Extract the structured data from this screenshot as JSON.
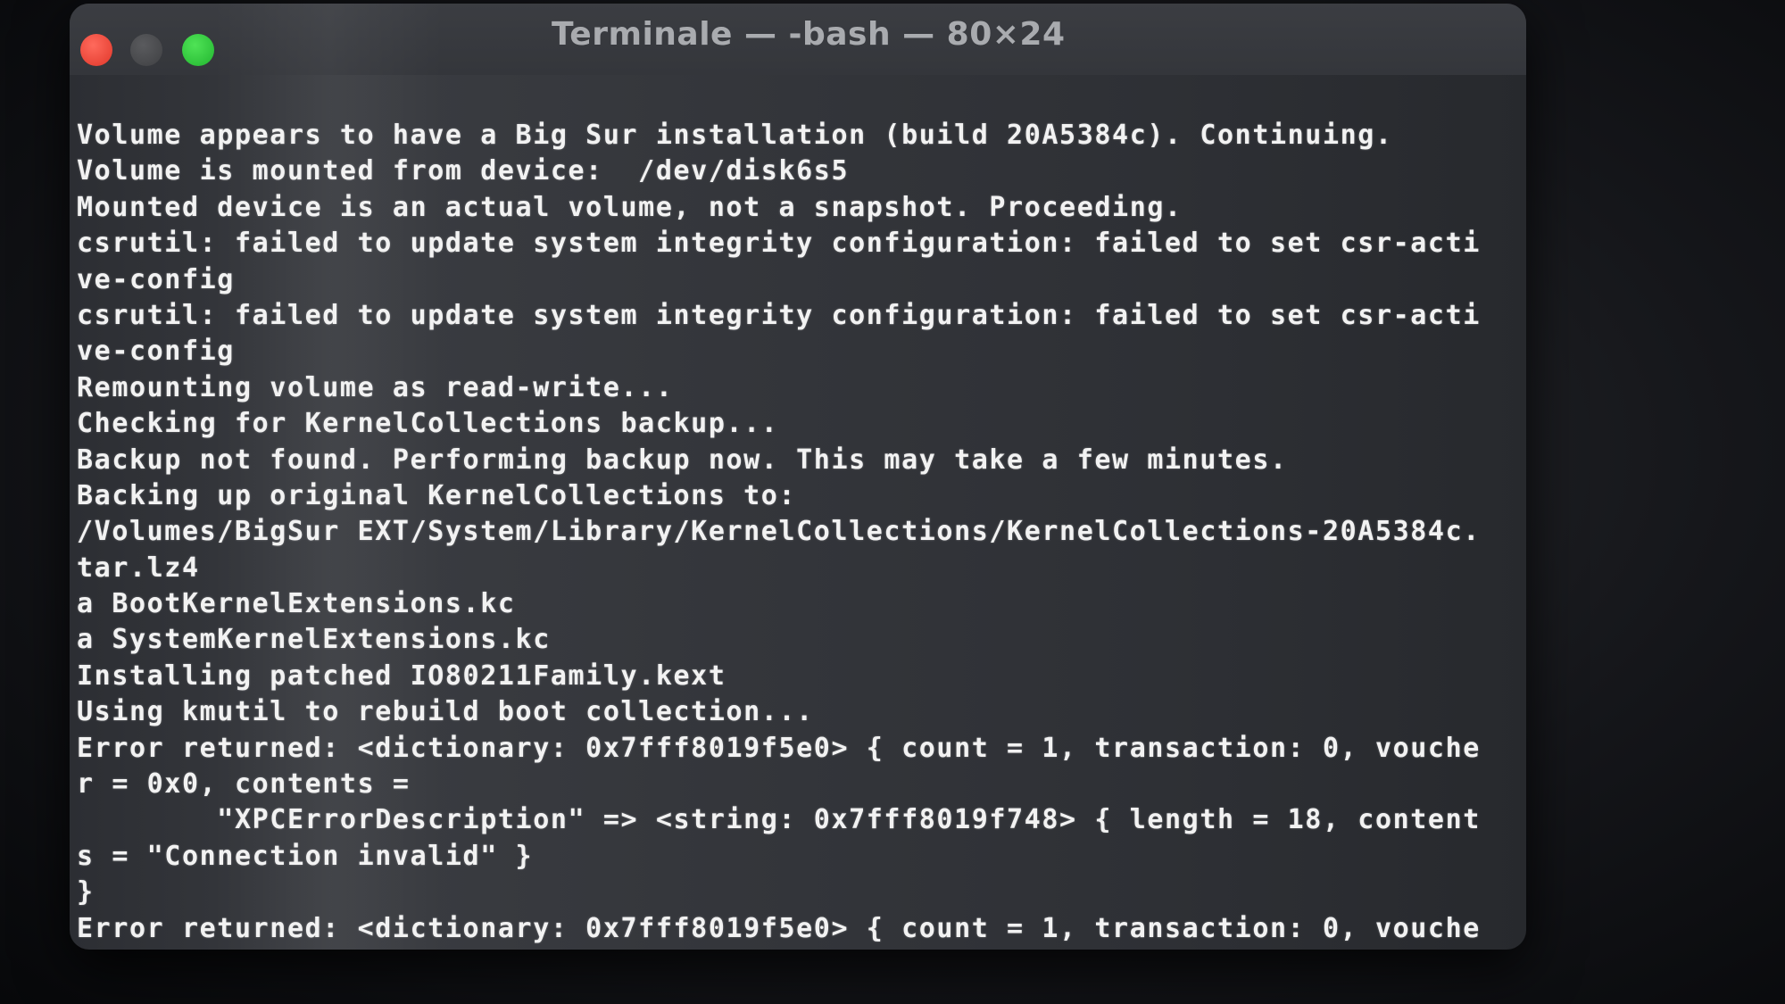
{
  "window": {
    "title": "Terminale — -bash — 80×24"
  },
  "terminal": {
    "lines": [
      "Volume appears to have a Big Sur installation (build 20A5384c). Continuing.",
      "Volume is mounted from device:  /dev/disk6s5",
      "Mounted device is an actual volume, not a snapshot. Proceeding.",
      "csrutil: failed to update system integrity configuration: failed to set csr-acti",
      "ve-config",
      "csrutil: failed to update system integrity configuration: failed to set csr-acti",
      "ve-config",
      "Remounting volume as read-write...",
      "Checking for KernelCollections backup...",
      "Backup not found. Performing backup now. This may take a few minutes.",
      "Backing up original KernelCollections to:",
      "/Volumes/BigSur EXT/System/Library/KernelCollections/KernelCollections-20A5384c.",
      "tar.lz4",
      "a BootKernelExtensions.kc",
      "a SystemKernelExtensions.kc",
      "Installing patched IO80211Family.kext",
      "Using kmutil to rebuild boot collection...",
      "Error returned: <dictionary: 0x7fff8019f5e0> { count = 1, transaction: 0, vouche",
      "r = 0x0, contents =",
      "        \"XPCErrorDescription\" => <string: 0x7fff8019f748> { length = 18, content",
      "s = \"Connection invalid\" }",
      "}",
      "Error returned: <dictionary: 0x7fff8019f5e0> { count = 1, transaction: 0, vouche"
    ]
  }
}
